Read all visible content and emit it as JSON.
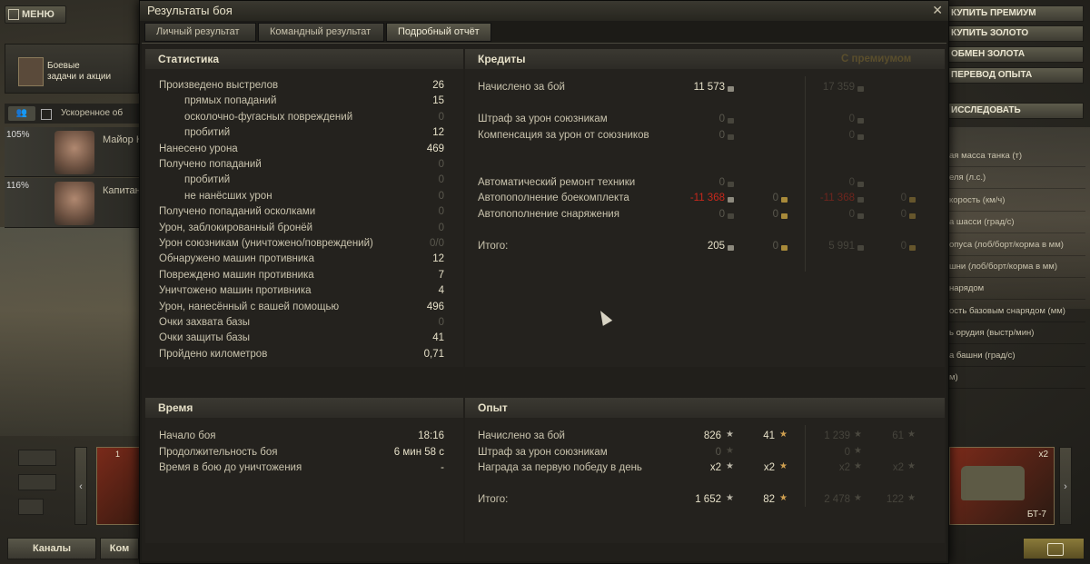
{
  "garage": {
    "menu_label": "МЕНЮ",
    "quests_label_1": "Боевые",
    "quests_label_2": "задачи и акции",
    "crew_filter_label": "Ускоренное об",
    "crew": [
      {
        "pct": "105%",
        "name": "Майор К"
      },
      {
        "pct": "116%",
        "name": "Капитан"
      }
    ],
    "right_buttons": [
      "КУПИТЬ ПРЕМИУМ",
      "КУПИТЬ ЗОЛОТО",
      "ОБМЕН ЗОЛОТА",
      "ПЕРЕВОД ОПЫТА",
      "ИССЛЕДОВАТЬ"
    ],
    "right_params": [
      "ая масса танка (т)",
      "еля (л.с.)",
      "корость (км/ч)",
      "а шасси (град/с)",
      "опуса (лоб/борт/корма в мм)",
      "шни (лоб/борт/корма в мм)",
      "нарядом",
      "ость базовым снарядом (мм)",
      "ь орудия (выстр/мин)",
      "а башни (град/с)",
      "м)"
    ],
    "tank_name": "БТ-7",
    "tank_mult": "x2",
    "channels_label": "Каналы",
    "bottom_btn2": "Ком",
    "left_card_num": "1"
  },
  "window": {
    "title": "Результаты боя",
    "close": "✕",
    "tabs": [
      "Личный результат",
      "Командный результат",
      "Подробный отчёт"
    ],
    "active_tab": 2
  },
  "stats": {
    "header": "Статистика",
    "rows": [
      {
        "label": "Произведено выстрелов",
        "value": "26",
        "indent": false,
        "dim": false
      },
      {
        "label": "прямых попаданий",
        "value": "15",
        "indent": true,
        "dim": false
      },
      {
        "label": "осколочно-фугасных повреждений",
        "value": "0",
        "indent": true,
        "dim": true
      },
      {
        "label": "пробитий",
        "value": "12",
        "indent": true,
        "dim": false
      },
      {
        "label": "Нанесено урона",
        "value": "469",
        "indent": false,
        "dim": false
      },
      {
        "label": "Получено попаданий",
        "value": "0",
        "indent": false,
        "dim": true
      },
      {
        "label": "пробитий",
        "value": "0",
        "indent": true,
        "dim": true
      },
      {
        "label": "не нанёсших урон",
        "value": "0",
        "indent": true,
        "dim": true
      },
      {
        "label": "Получено попаданий осколками",
        "value": "0",
        "indent": false,
        "dim": true
      },
      {
        "label": "Урон, заблокированный бронёй",
        "value": "0",
        "indent": false,
        "dim": true
      },
      {
        "label": "Урон союзникам (уничтожено/повреждений)",
        "value": "0/0",
        "indent": false,
        "dim": true
      },
      {
        "label": "Обнаружено машин противника",
        "value": "12",
        "indent": false,
        "dim": false
      },
      {
        "label": "Повреждено машин противника",
        "value": "7",
        "indent": false,
        "dim": false
      },
      {
        "label": "Уничтожено машин противника",
        "value": "4",
        "indent": false,
        "dim": false
      },
      {
        "label": "Урон, нанесённый с вашей помощью",
        "value": "496",
        "indent": false,
        "dim": false
      },
      {
        "label": "Очки захвата базы",
        "value": "0",
        "indent": false,
        "dim": true
      },
      {
        "label": "Очки защиты базы",
        "value": "41",
        "indent": false,
        "dim": false
      },
      {
        "label": "Пройдено километров",
        "value": "0,71",
        "indent": false,
        "dim": false
      }
    ]
  },
  "credits": {
    "header": "Кредиты",
    "premium_header": "С премиумом",
    "rows": [
      {
        "label": "Начислено за бой",
        "c1": "11 573",
        "c2": "",
        "c3": "17 359",
        "c4": ""
      },
      {
        "label": "Штраф за урон союзникам",
        "c1": "0",
        "c2": "",
        "c3": "0",
        "c4": ""
      },
      {
        "label": "Компенсация за урон от союзников",
        "c1": "0",
        "c2": "",
        "c3": "0",
        "c4": ""
      },
      {
        "label": "Автоматический ремонт техники",
        "c1": "0",
        "c2": "",
        "c3": "0",
        "c4": ""
      },
      {
        "label": "Автопополнение боекомплекта",
        "c1": "-11 368",
        "c2": "0",
        "c3": "-11 368",
        "c4": "0"
      },
      {
        "label": "Автопополнение снаряжения",
        "c1": "0",
        "c2": "0",
        "c3": "0",
        "c4": "0"
      },
      {
        "label": "Итого:",
        "c1": "205",
        "c2": "0",
        "c3": "5 991",
        "c4": "0"
      }
    ]
  },
  "time": {
    "header": "Время",
    "rows": [
      {
        "label": "Начало боя",
        "value": "18:16"
      },
      {
        "label": "Продолжительность боя",
        "value": "6 мин 58 с"
      },
      {
        "label": "Время в бою до уничтожения",
        "value": "-"
      }
    ]
  },
  "exp": {
    "header": "Опыт",
    "rows": [
      {
        "label": "Начислено за бой",
        "c1": "826",
        "c2": "41",
        "c3": "1 239",
        "c4": "61"
      },
      {
        "label": "Штраф за урон союзникам",
        "c1": "0",
        "c2": "",
        "c3": "0",
        "c4": ""
      },
      {
        "label": "Награда за первую победу в день",
        "c1": "x2",
        "c2": "x2",
        "c3": "x2",
        "c4": "x2"
      },
      {
        "label": "Итого:",
        "c1": "1 652",
        "c2": "82",
        "c3": "2 478",
        "c4": "122"
      }
    ]
  },
  "colors": {
    "negative": "#c8281c",
    "premium": "#5a4e2c",
    "gold": "#d0a050"
  }
}
